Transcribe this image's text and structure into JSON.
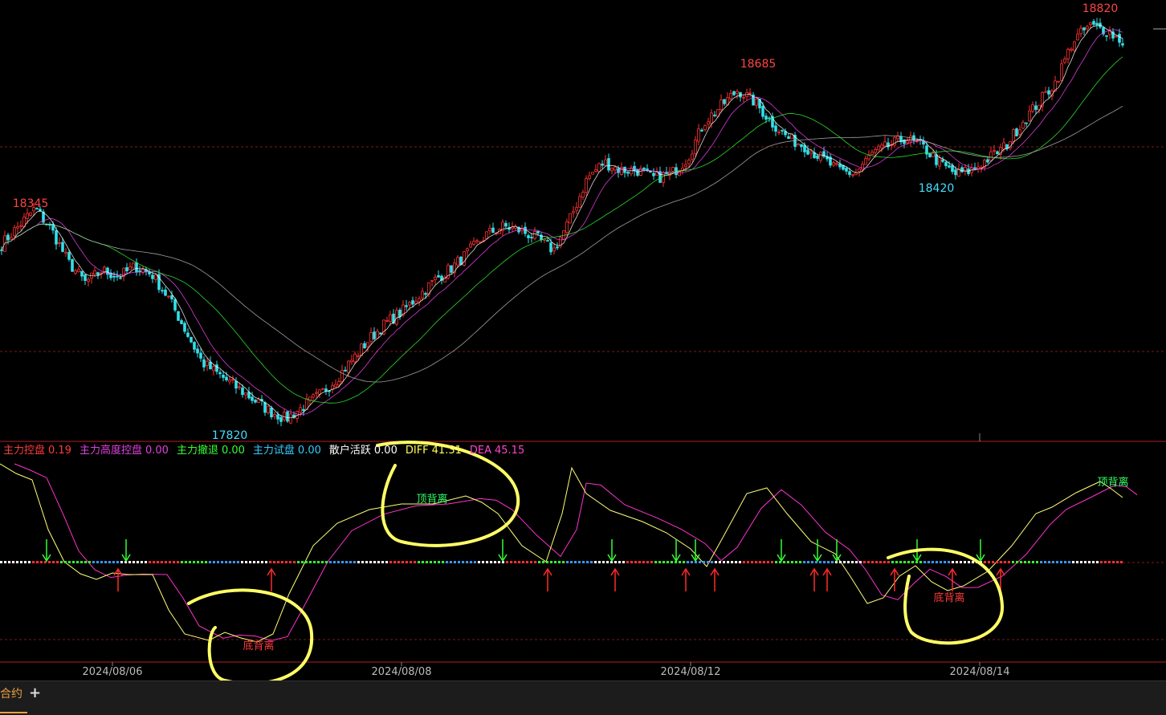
{
  "legend": [
    {
      "label": "主力控盘",
      "value": "0.19",
      "label_color": "#ff3b3b",
      "value_color": "#ff3b3b"
    },
    {
      "label": "主力高度控盘",
      "value": "0.00",
      "label_color": "#e040e0",
      "value_color": "#e040e0"
    },
    {
      "label": "主力撤退",
      "value": "0.00",
      "label_color": "#33ff33",
      "value_color": "#33ff33"
    },
    {
      "label": "主力试盘",
      "value": "0.00",
      "label_color": "#33ccff",
      "value_color": "#33ccff"
    },
    {
      "label": "散户活跃",
      "value": "0.00",
      "label_color": "#ffffff",
      "value_color": "#ffffff"
    },
    {
      "label": "DIFF",
      "value": "41.31",
      "label_color": "#ffff55",
      "value_color": "#ffff55"
    },
    {
      "label": "DEA",
      "value": "45.15",
      "label_color": "#ff44cc",
      "value_color": "#ff44cc"
    }
  ],
  "chart_data": {
    "type": "candlestick",
    "x_ticks": [
      "2024/08/06",
      "2024/08/08",
      "2024/08/12",
      "2024/08/14"
    ],
    "price_annotations": [
      {
        "text": "18345",
        "kind": "high",
        "color": "#ff4444"
      },
      {
        "text": "17820",
        "kind": "low",
        "color": "#44ddff"
      },
      {
        "text": "18685",
        "kind": "high",
        "color": "#ff4444"
      },
      {
        "text": "18420",
        "kind": "low",
        "color": "#44ddff"
      },
      {
        "text": "18820",
        "kind": "high",
        "color": "#ff4444"
      }
    ],
    "close_path": [
      18255,
      18300,
      18345,
      18290,
      18210,
      18160,
      18190,
      18175,
      18200,
      18180,
      18120,
      18040,
      17960,
      17930,
      17900,
      17870,
      17840,
      17820,
      17850,
      17880,
      17920,
      17970,
      18020,
      18060,
      18090,
      18130,
      18170,
      18200,
      18240,
      18280,
      18300,
      18290,
      18270,
      18240,
      18320,
      18420,
      18460,
      18440,
      18440,
      18420,
      18430,
      18470,
      18560,
      18600,
      18640,
      18610,
      18560,
      18520,
      18500,
      18470,
      18440,
      18430,
      18480,
      18500,
      18520,
      18500,
      18460,
      18430,
      18440,
      18470,
      18500,
      18560,
      18610,
      18660,
      18760,
      18800,
      18790,
      18760
    ],
    "panel2_labels": [
      {
        "text": "顶背离",
        "color": "#33ff66"
      },
      {
        "text": "底背离",
        "color": "#ff3b3b"
      },
      {
        "text": "底背离",
        "color": "#ff3b3b"
      },
      {
        "text": "顶背离",
        "color": "#33ff66"
      }
    ]
  },
  "tabs": {
    "active": "合约",
    "add": "+"
  }
}
